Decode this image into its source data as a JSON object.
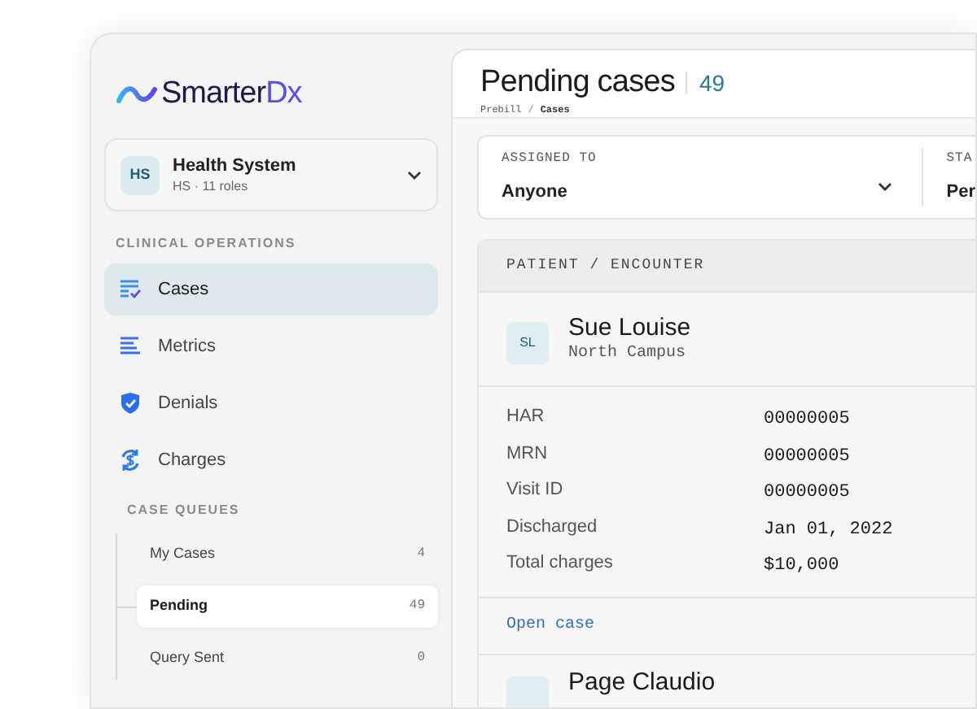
{
  "brand": {
    "name_part_1": "Smarter",
    "name_part_2": "Dx"
  },
  "organization": {
    "initials": "HS",
    "name": "Health System",
    "subtitle": "HS · 11 roles"
  },
  "nav_section": "CLINICAL OPERATIONS",
  "nav_items": [
    {
      "kind": "cases",
      "label": "Cases",
      "selected": true
    },
    {
      "kind": "metrics",
      "label": "Metrics",
      "selected": false
    },
    {
      "kind": "denials",
      "label": "Denials",
      "selected": false
    },
    {
      "kind": "charges",
      "label": "Charges",
      "selected": false
    }
  ],
  "queue_section": "CASE QUEUES",
  "queues": [
    {
      "label": "My Cases",
      "count": "4",
      "selected": false
    },
    {
      "label": "Pending",
      "count": "49",
      "selected": true
    },
    {
      "label": "Query Sent",
      "count": "0",
      "selected": false
    }
  ],
  "page": {
    "title": "Pending cases",
    "count": "49",
    "breadcrumb": [
      "Prebill",
      "Cases"
    ],
    "breadcrumb_separator": "/"
  },
  "filters": [
    {
      "label": "ASSIGNED TO",
      "value": "Anyone",
      "dropdown": true
    },
    {
      "label": "STA",
      "value": "Per",
      "dropdown": false
    }
  ],
  "table": {
    "header": "PATIENT / ENCOUNTER",
    "patients": [
      {
        "initials": "SL",
        "name": "Sue Louise",
        "location": "North Campus",
        "fields": [
          {
            "label": "HAR",
            "value": "00000005"
          },
          {
            "label": "MRN",
            "value": "00000005"
          },
          {
            "label": "Visit ID",
            "value": "00000005"
          },
          {
            "label": "Discharged",
            "value": "Jan 01, 2022"
          },
          {
            "label": "Total charges",
            "value": "$10,000"
          }
        ],
        "link": "Open case"
      },
      {
        "name": "Page Claudio"
      }
    ]
  }
}
